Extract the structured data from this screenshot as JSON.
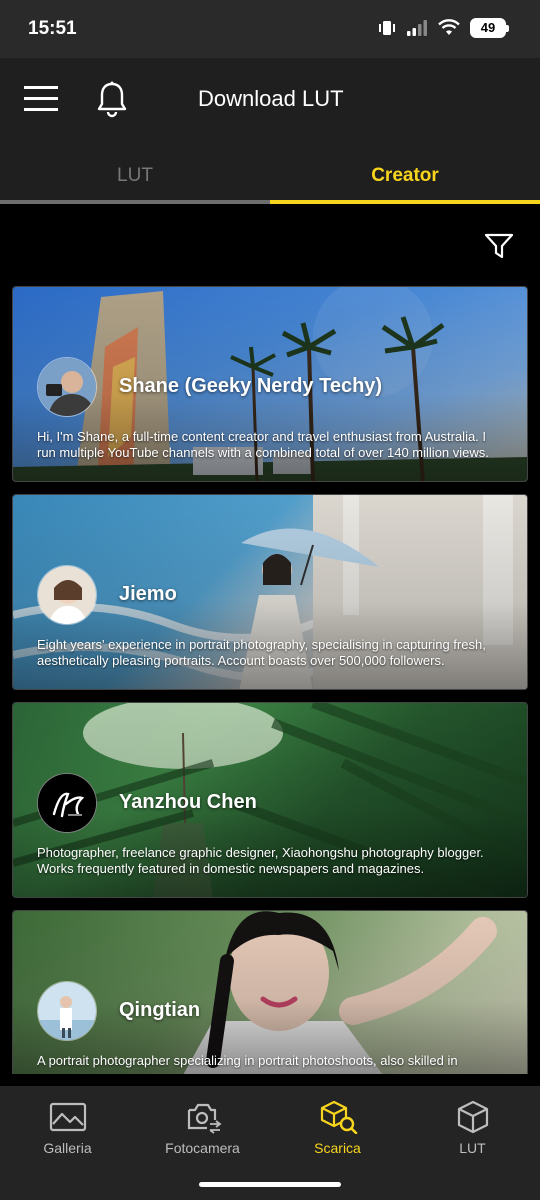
{
  "status_bar": {
    "time": "15:51",
    "battery": "49",
    "icons": [
      "vibrate-icon",
      "signal-icon",
      "wifi-icon",
      "battery-icon"
    ]
  },
  "header": {
    "title": "Download LUT",
    "menu_icon": "hamburger-menu-icon",
    "bell_icon": "bell-icon"
  },
  "tabs": [
    {
      "label": "LUT",
      "active": false
    },
    {
      "label": "Creator",
      "active": true
    }
  ],
  "filter_icon": "filter-icon",
  "creators": [
    {
      "name": "Shane (Geeky Nerdy Techy)",
      "description": "Hi, I'm Shane, a full-time content creator and travel enthusiast from Australia. I run multiple YouTube channels with a combined total of over 140 million views."
    },
    {
      "name": "Jiemo",
      "description": "Eight years' experience in portrait photography, specialising in capturing fresh, aesthetically pleasing portraits. Account boasts over 500,000 followers."
    },
    {
      "name": "Yanzhou Chen",
      "description": "Photographer, freelance graphic designer, Xiaohongshu photography blogger. Works frequently featured in domestic newspapers and magazines."
    },
    {
      "name": "Qingtian",
      "description": "A portrait photographer specializing in portrait photoshoots, also skilled in"
    }
  ],
  "bottom_nav": [
    {
      "label": "Galleria",
      "icon": "gallery-icon",
      "active": false
    },
    {
      "label": "Fotocamera",
      "icon": "camera-switch-icon",
      "active": false
    },
    {
      "label": "Scarica",
      "icon": "download-search-icon",
      "active": true
    },
    {
      "label": "LUT",
      "icon": "cube-icon",
      "active": false
    }
  ],
  "colors": {
    "accent": "#f7d51d",
    "background": "#000000",
    "header_bg": "#1f1f1f",
    "nav_bg": "#242424",
    "inactive_tab": "#777777"
  }
}
